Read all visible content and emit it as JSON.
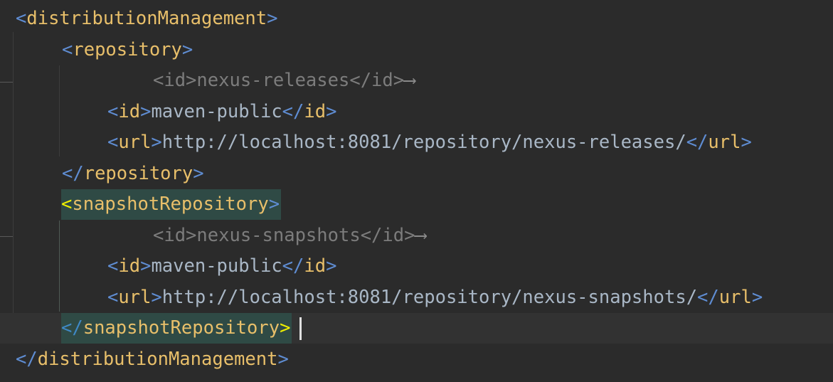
{
  "editor": {
    "language": "xml",
    "lines": [
      {
        "open": "<",
        "name": "distributionManagement",
        "close": ">"
      },
      {
        "open": "<",
        "name": "repository",
        "close": ">"
      },
      {
        "text": "<id>nexus-releases</id>",
        "arrow": "⟶"
      },
      {
        "open": "<",
        "name": "id",
        "close": ">",
        "value": "maven-public",
        "end_open": "</",
        "end_name": "id",
        "end_close": ">"
      },
      {
        "open": "<",
        "name": "url",
        "close": ">",
        "value": "http://localhost:8081/repository/nexus-releases/",
        "end_open": "</",
        "end_name": "url",
        "end_close": ">"
      },
      {
        "open": "</",
        "name": "repository",
        "close": ">"
      },
      {
        "open": "<",
        "name": "snapshotRepository",
        "close": ">"
      },
      {
        "text": "<id>nexus-snapshots</id>",
        "arrow": "⟶"
      },
      {
        "open": "<",
        "name": "id",
        "close": ">",
        "value": "maven-public",
        "end_open": "</",
        "end_name": "id",
        "end_close": ">"
      },
      {
        "open": "<",
        "name": "url",
        "close": ">",
        "value": "http://localhost:8081/repository/nexus-snapshots/",
        "end_open": "</",
        "end_name": "url",
        "end_close": ">"
      },
      {
        "open": "</",
        "name": "snapshotRepository",
        "close": ">"
      },
      {
        "open": "</",
        "name": "distributionManagement",
        "close": ">"
      }
    ]
  },
  "colors": {
    "background": "#2b2b2b",
    "tag_name": "#e8bf6a",
    "text": "#a9b7c6",
    "bracket": "#5f8dd3",
    "comment_like": "#7c7c7c",
    "tag_highlight": "#2f4a45"
  }
}
